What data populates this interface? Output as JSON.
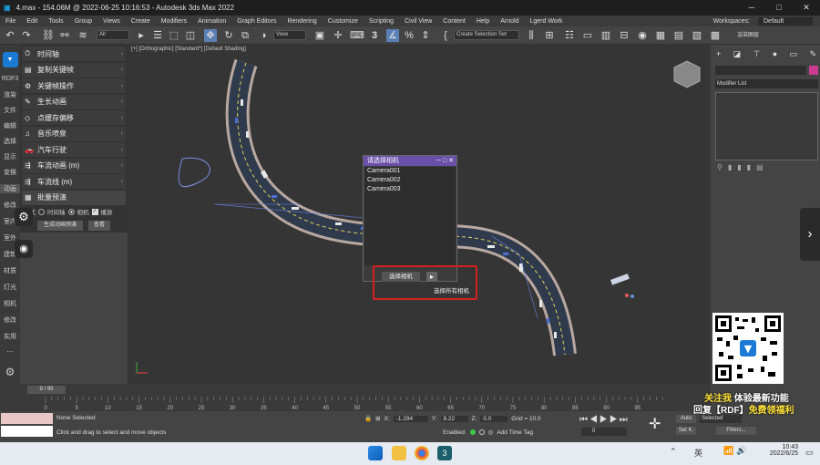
{
  "window": {
    "title": "4.max - 154.06M @ 2022-06-25 10:16:53 - Autodesk 3ds Max 2022",
    "min": "─",
    "max": "□",
    "close": "✕"
  },
  "menu": [
    "File",
    "Edit",
    "Tools",
    "Group",
    "Views",
    "Create",
    "Modifiers",
    "Animation",
    "Graph Editors",
    "Rendering",
    "Customize",
    "Scripting",
    "Civil View",
    "Content",
    "Help",
    "Arnold",
    "Lgerd Work"
  ],
  "workspace": {
    "label": "Workspaces:",
    "value": "Default"
  },
  "toolbar": {
    "filter": "All",
    "view": "View",
    "selection_set": "Create Selection Set",
    "snap": "3"
  },
  "left_labels": [
    "RDF3",
    "渲染",
    "文件",
    "编辑",
    "选择",
    "显示",
    "变换",
    "动画",
    "修改",
    "室内",
    "室外",
    "建筑",
    "材质",
    "灯光",
    "相机",
    "修改",
    "实用",
    "⋯"
  ],
  "plugin_items": [
    {
      "icon": "⏱",
      "label": "时间轴"
    },
    {
      "icon": "▤",
      "label": "复制关键帧"
    },
    {
      "icon": "⚙",
      "label": "关键帧操作"
    },
    {
      "icon": "✎",
      "label": "生长动画"
    },
    {
      "icon": "◇",
      "label": "点缓存偏移"
    },
    {
      "icon": "♫",
      "label": "音乐喷泉"
    },
    {
      "icon": "🚗",
      "label": "汽车行驶"
    },
    {
      "icon": "⇶",
      "label": "车流动画 (m)"
    },
    {
      "icon": "⇶",
      "label": "车流线 (m)"
    },
    {
      "icon": "▦",
      "label": "批量预演"
    }
  ],
  "preview_opts": {
    "label": "模式",
    "opt1": "时间轴",
    "opt2": "相机",
    "opt3": "播放"
  },
  "preview_btns": {
    "gen": "生成动画预演",
    "view": "查看"
  },
  "viewport": {
    "label": "[+] [Orthographic] [Standard*] [Default Shading]"
  },
  "dialog": {
    "title": "请选择相机",
    "cameras": [
      "Camera001",
      "Camera002",
      "Camera003"
    ],
    "select_btn": "选择相机",
    "tooltip": "选择所有相机"
  },
  "cmd": {
    "modifier_list": "Modifier List"
  },
  "timeline": {
    "frame": "9 / 99",
    "ticks": [
      "0",
      "5",
      "10",
      "15",
      "20",
      "25",
      "30",
      "35",
      "40",
      "45",
      "50",
      "55",
      "60",
      "65",
      "70",
      "75",
      "80",
      "85",
      "90",
      "95"
    ]
  },
  "status": {
    "none_selected": "None Selected",
    "prompt": "Click and drag to select and move objects",
    "x_label": "X:",
    "x_val": "-1.294",
    "y_label": "Y:",
    "y_val": "8.22",
    "z_label": "Z:",
    "z_val": "0.0",
    "grid": "Grid = 10.0",
    "enabled": "Enabled:",
    "add_tag": "Add Time Tag",
    "auto": "Auto",
    "selected": "Selected",
    "setk": "Set K.",
    "filters": "Filters...",
    "frame": "0"
  },
  "promo": {
    "line1a": "关注我",
    "line1b": " 体验最新功能",
    "line2a": "回复【RDF】",
    "line2b": "免费领福利"
  },
  "taskbar": {
    "lang": "英",
    "time": "10:43",
    "date": "2022/6/25"
  },
  "colors": {
    "accent": "#1a7ad4",
    "dialog_header": "#6a50a8",
    "highlight": "#d42020",
    "promo_yellow": "#ffe23a"
  }
}
